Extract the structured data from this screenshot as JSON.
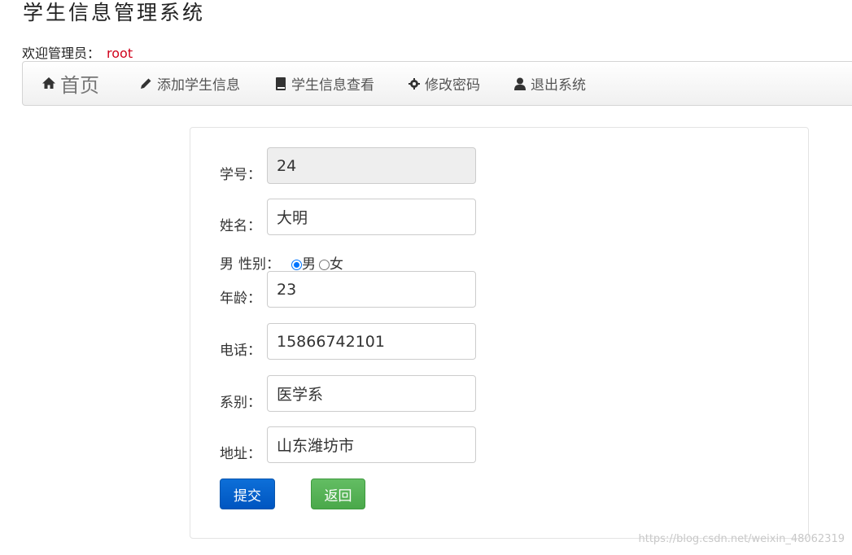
{
  "app": {
    "title": "学生信息管理系统"
  },
  "welcome": {
    "label": "欢迎管理员：",
    "username": "root"
  },
  "nav": {
    "home": "首页",
    "add_student": "添加学生信息",
    "view_students": "学生信息查看",
    "change_password": "修改密码",
    "logout": "退出系统"
  },
  "form": {
    "student_id": {
      "label": "学号：",
      "value": "24"
    },
    "name": {
      "label": "姓名：",
      "value": "大明"
    },
    "gender": {
      "current": "男",
      "label": "性别：",
      "options": [
        "男",
        "女"
      ],
      "selected": "男"
    },
    "age": {
      "label": "年龄：",
      "value": "23"
    },
    "phone": {
      "label": "电话：",
      "value": "15866742101"
    },
    "department": {
      "label": "系别：",
      "value": "医学系"
    },
    "address": {
      "label": "地址：",
      "value": "山东潍坊市"
    },
    "submit_label": "提交",
    "back_label": "返回"
  },
  "watermark": "https://blog.csdn.net/weixin_48062319"
}
